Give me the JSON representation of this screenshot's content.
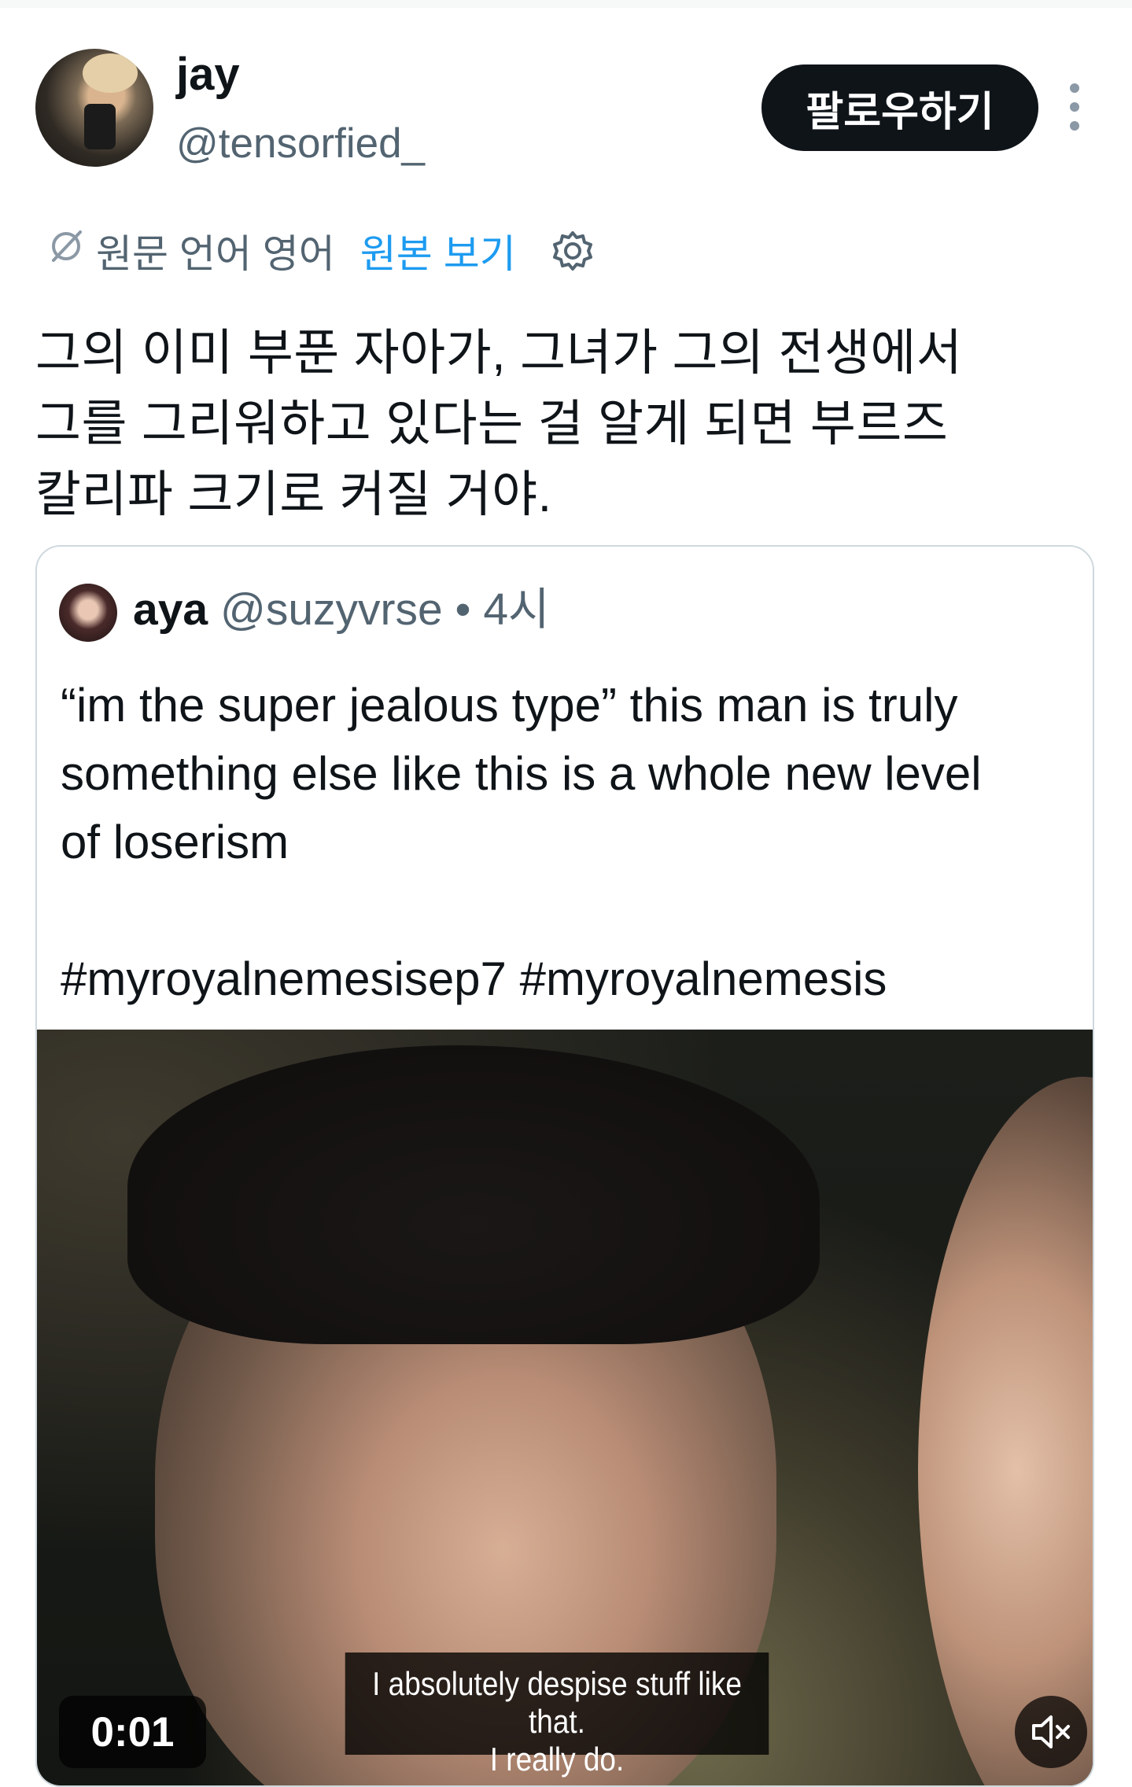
{
  "author": {
    "name": "jay",
    "handle": "@tensorfied_",
    "follow_label": "팔로우하기"
  },
  "translation": {
    "language_note": "원문 언어 영어",
    "show_original_label": "원본 보기"
  },
  "tweet": {
    "text": "그의 이미 부푼 자아가, 그녀가 그의 전생에서\n그를 그리워하고 있다는 걸 알게 되면 부르즈\n칼리파 크기로 커질 거야."
  },
  "quoted": {
    "name": "aya",
    "handle": "@suzyvrse",
    "separator": "•",
    "time": "4시",
    "text": "“im the super jealous type” this man is truly\nsomething else like this is a whole new level\nof loserism\n\n#myroyalnemesisep7 #myroyalnemesis",
    "video": {
      "subtitle_line1": "I absolutely despise stuff like that.",
      "subtitle_line2": "I really do.",
      "timestamp": "0:01"
    }
  },
  "colors": {
    "secondary_text": "#536471",
    "link": "#1d9bf0",
    "follow_bg": "#0f1419",
    "border": "#cfd9de"
  },
  "icons": [
    "translate-icon",
    "gear-icon",
    "more-icon",
    "mute-icon"
  ]
}
